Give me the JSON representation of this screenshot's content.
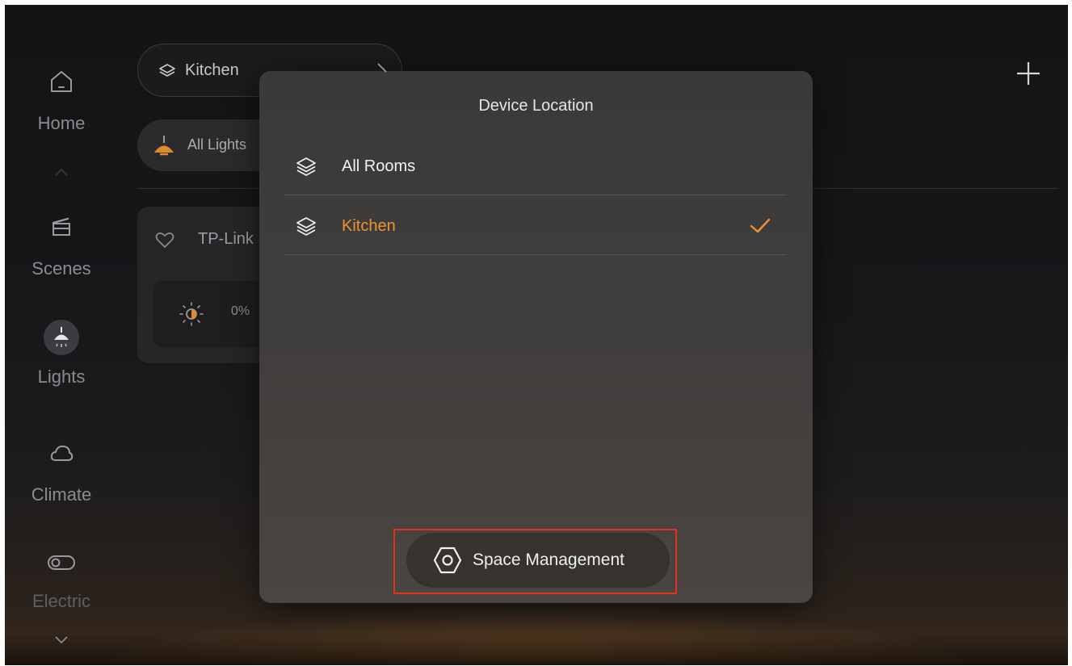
{
  "sidebar": {
    "items": [
      {
        "label": "Home",
        "icon": "home-icon"
      },
      {
        "label": "Scenes",
        "icon": "clapperboard-icon"
      },
      {
        "label": "Lights",
        "icon": "lamp-icon"
      },
      {
        "label": "Climate",
        "icon": "cloud-icon"
      },
      {
        "label": "Electric",
        "icon": "toggle-icon"
      }
    ]
  },
  "room_selector": {
    "label": "Kitchen",
    "icon": "layers-icon"
  },
  "filter": {
    "label": "All Lights",
    "icon": "lamp-icon"
  },
  "device": {
    "name": "TP-Link",
    "brightness": "0%"
  },
  "modal": {
    "title": "Device Location",
    "options": [
      {
        "label": "All Rooms",
        "icon": "layers-icon",
        "selected": false
      },
      {
        "label": "Kitchen",
        "icon": "layers-icon",
        "selected": true
      }
    ],
    "space_button": {
      "label": "Space Management",
      "icon": "hexagon-settings-icon"
    }
  },
  "colors": {
    "accent": "#f0922e",
    "highlight": "#e0331b",
    "modal_bg": "#3d3b3a"
  }
}
